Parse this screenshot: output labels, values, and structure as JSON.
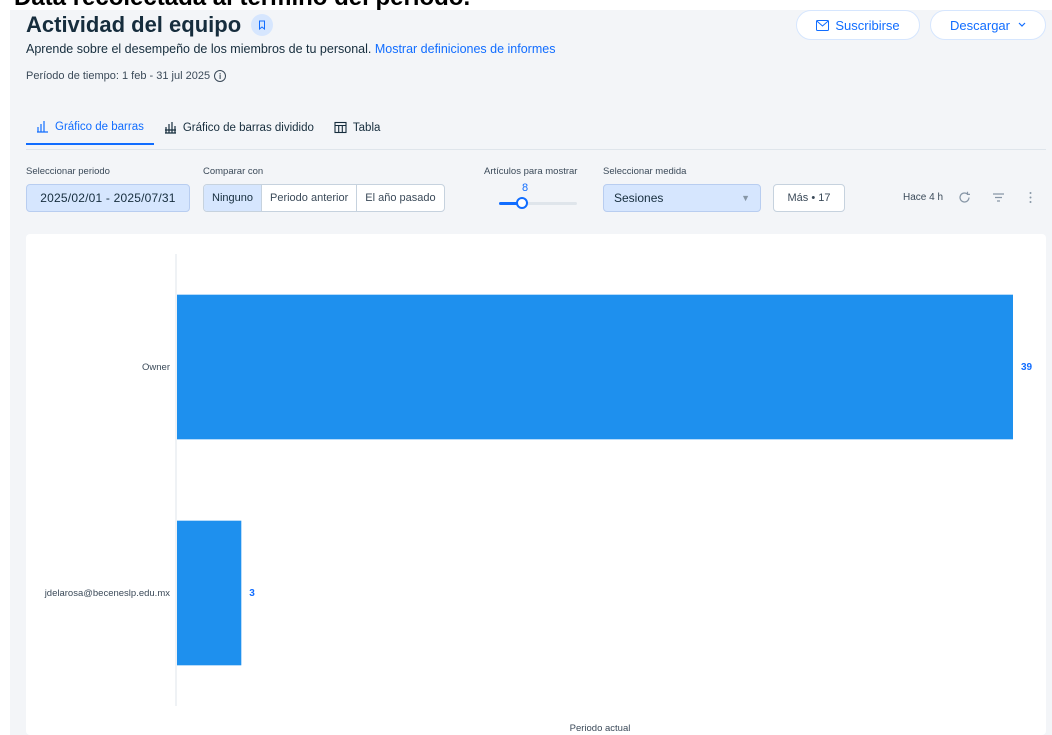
{
  "caption": "Data recolectada al término del periodo.",
  "header": {
    "title": "Actividad del equipo",
    "subtitle": "Aprende sobre el desempeño de los miembros de tu personal.",
    "subtitle_link": "Mostrar definiciones de informes",
    "period": "Período de tiempo: 1 feb - 31 jul 2025"
  },
  "actions": {
    "subscribe": "Suscribirse",
    "download": "Descargar"
  },
  "tabs": [
    {
      "label": "Gráfico de barras",
      "icon": "bar-chart-icon",
      "active": true
    },
    {
      "label": "Gráfico de barras dividido",
      "icon": "stacked-bar-chart-icon",
      "active": false
    },
    {
      "label": "Tabla",
      "icon": "table-icon",
      "active": false
    }
  ],
  "controls": {
    "period_label": "Seleccionar periodo",
    "period_value": "2025/02/01 - 2025/07/31",
    "compare_label": "Comparar con",
    "compare_options": [
      "Ninguno",
      "Periodo anterior",
      "El año pasado"
    ],
    "compare_selected": "Ninguno",
    "items_label": "Artículos para mostrar",
    "items_value": "8",
    "items_fraction": 0.3,
    "measure_label": "Seleccionar medida",
    "measure_value": "Sesiones",
    "more_label": "Más • 17",
    "updated": "Hace 4 h"
  },
  "colors": {
    "accent": "#116dff",
    "bar": "#1e90ee"
  },
  "chart_data": {
    "type": "bar",
    "orientation": "horizontal",
    "categories": [
      "Owner",
      "jdelarosa@beceneslp.edu.mx"
    ],
    "values": [
      39,
      3
    ],
    "xlabel": "Periodo actual",
    "xlim": [
      0,
      39
    ]
  }
}
